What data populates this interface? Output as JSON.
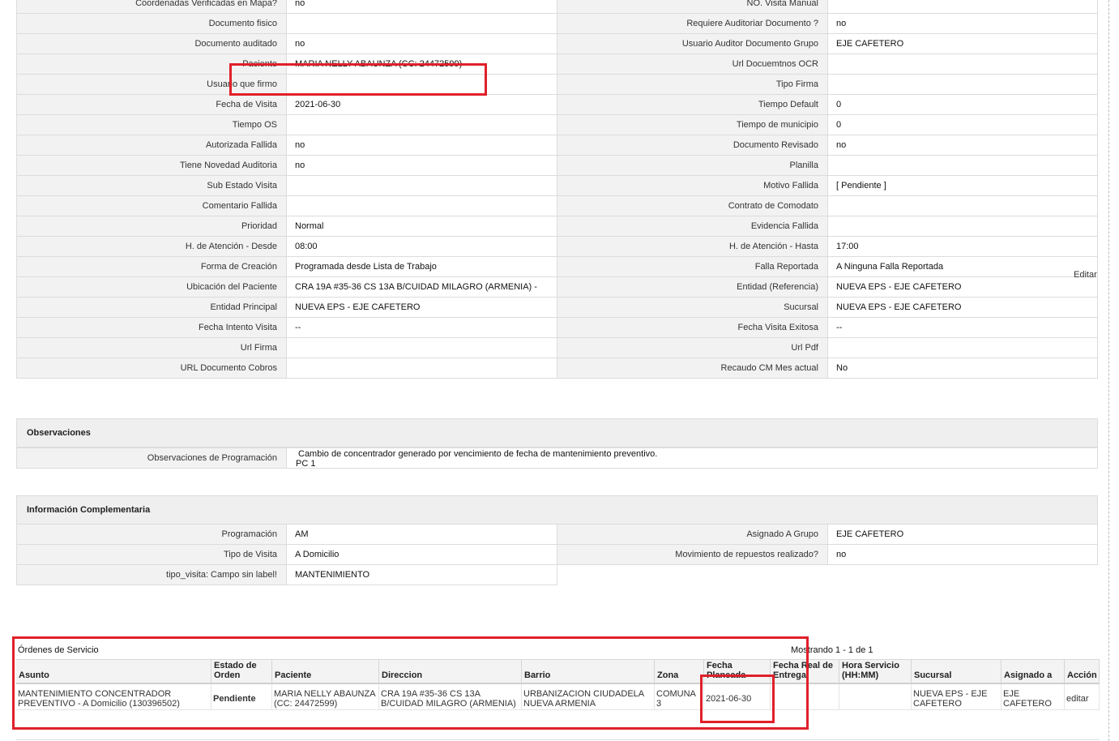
{
  "detail_rows": [
    [
      {
        "label": "Coordenadas Verificadas en Mapa?",
        "value": "no"
      },
      {
        "label": "NO. Visita Manual",
        "value": ""
      }
    ],
    [
      {
        "label": "Documento fisico",
        "value": ""
      },
      {
        "label": "Requiere Auditoriar Documento ?",
        "value": "no"
      }
    ],
    [
      {
        "label": "Documento auditado",
        "value": "no"
      },
      {
        "label": "Usuario Auditor Documento Grupo",
        "value": "EJE CAFETERO"
      }
    ],
    [
      {
        "label": "Paciente",
        "value": "MARIA NELLY ABAUNZA (CC: 24472599)"
      },
      {
        "label": "Url Docuemtnos OCR",
        "value": ""
      }
    ],
    [
      {
        "label": "Usuario que firmo",
        "value": ""
      },
      {
        "label": "Tipo Firma",
        "value": ""
      }
    ],
    [
      {
        "label": "Fecha de Visita",
        "value": "2021-06-30"
      },
      {
        "label": "Tiempo Default",
        "value": "0"
      }
    ],
    [
      {
        "label": "Tiempo OS",
        "value": ""
      },
      {
        "label": "Tiempo de municipio",
        "value": "0"
      }
    ],
    [
      {
        "label": "Autorizada Fallida",
        "value": "no"
      },
      {
        "label": "Documento Revisado",
        "value": "no"
      }
    ],
    [
      {
        "label": "Tiene Novedad Auditoria",
        "value": "no"
      },
      {
        "label": "Planilla",
        "value": ""
      }
    ],
    [
      {
        "label": "Sub Estado Visita",
        "value": ""
      },
      {
        "label": "Motivo Fallida",
        "value": "[ Pendiente ]"
      }
    ],
    [
      {
        "label": "Comentario Fallida",
        "value": ""
      },
      {
        "label": "Contrato de Comodato",
        "value": ""
      }
    ],
    [
      {
        "label": "Prioridad",
        "value": "Normal"
      },
      {
        "label": "Evidencia Fallida",
        "value": ""
      }
    ],
    [
      {
        "label": "H. de Atención - Desde",
        "value": "08:00"
      },
      {
        "label": "H. de Atención - Hasta",
        "value": "17:00"
      }
    ],
    [
      {
        "label": "Forma de Creación",
        "value": "Programada desde Lista de Trabajo"
      },
      {
        "label": "Falla Reportada",
        "value": "A Ninguna Falla Reportada"
      }
    ],
    [
      {
        "label": "Ubicación del Paciente",
        "value": "CRA 19A #35-36 CS 13A B/CUIDAD MILAGRO (ARMENIA) -"
      },
      {
        "label": "Entidad (Referencia)",
        "value": "NUEVA EPS - EJE CAFETERO"
      }
    ],
    [
      {
        "label": "Entidad Principal",
        "value": "NUEVA EPS - EJE CAFETERO"
      },
      {
        "label": "Sucursal",
        "value": "NUEVA EPS - EJE CAFETERO"
      }
    ],
    [
      {
        "label": "Fecha Intento Visita",
        "value": "--"
      },
      {
        "label": "Fecha Visita Exitosa",
        "value": "--"
      }
    ],
    [
      {
        "label": "Url Firma",
        "value": ""
      },
      {
        "label": "Url Pdf",
        "value": ""
      }
    ],
    [
      {
        "label": "URL Documento Cobros",
        "value": ""
      },
      {
        "label": "Recaudo CM Mes actual",
        "value": "No"
      }
    ]
  ],
  "edit_label": "Editar",
  "observaciones": {
    "title": "Observaciones",
    "label": "Observaciones de Programación",
    "line1": "Cambio de concentrador generado por vencimiento de fecha de mantenimiento preventivo.",
    "line2": "PC 1"
  },
  "complementaria": {
    "title": "Información Complementaria",
    "rows": [
      [
        {
          "label": "Programación",
          "value": "AM"
        },
        {
          "label": "Asignado A Grupo",
          "value": "EJE CAFETERO"
        }
      ],
      [
        {
          "label": "Tipo de Visita",
          "value": "A Domicilio"
        },
        {
          "label": "Movimiento de repuestos realizado?",
          "value": "no"
        }
      ],
      [
        {
          "label": "tipo_visita: Campo sin label!",
          "value": "MANTENIMIENTO"
        }
      ]
    ]
  },
  "orders": {
    "title": "Órdenes de Servicio",
    "count": "Mostrando 1 - 1 de 1",
    "headers": [
      "Asunto",
      "Estado de Orden",
      "Paciente",
      "Direccion",
      "Barrio",
      "Zona",
      "Fecha Planeada",
      "Fecha Real de Entrega",
      "Hora Servicio (HH:MM)",
      "Sucursal",
      "Asignado a",
      "Acción"
    ],
    "rows": [
      [
        "MANTENIMIENTO CONCENTRADOR PREVENTIVO - A Domicilio (130396502)",
        "Pendiente",
        "MARIA NELLY ABAUNZA (CC: 24472599)",
        "CRA 19A #35-36 CS 13A B/CUIDAD MILAGRO (ARMENIA)",
        "URBANIZACION CIUDADELA NUEVA ARMENIA",
        "COMUNA 3",
        "2021-06-30",
        "",
        "",
        "NUEVA EPS - EJE CAFETERO",
        "EJE CAFETERO",
        "editar"
      ]
    ]
  },
  "colors": {
    "highlight": "#e0202a",
    "label_bg": "#f2f2f2",
    "border": "#dcdcdc"
  }
}
